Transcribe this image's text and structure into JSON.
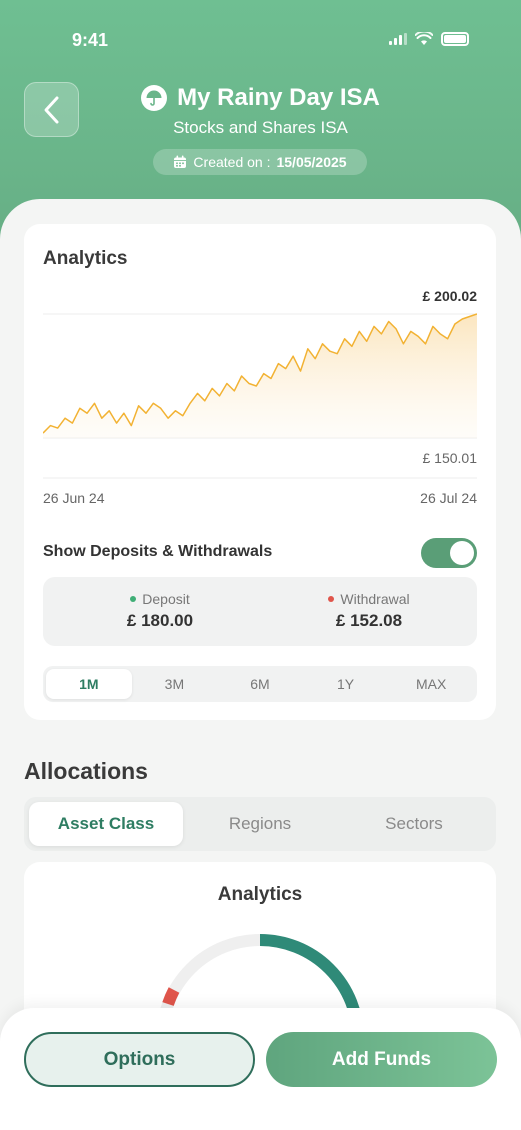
{
  "status_bar": {
    "time": "9:41"
  },
  "header": {
    "title": "My Rainy Day ISA",
    "subtitle": "Stocks and Shares ISA",
    "created_label": "Created on :",
    "created_date": "15/05/2025"
  },
  "analytics": {
    "title": "Analytics",
    "high_label": "£ 200.02",
    "low_label": "£ 150.01",
    "start_date": "26 Jun 24",
    "end_date": "26 Jul 24",
    "toggle_label": "Show Deposits & Withdrawals",
    "toggle_on": true,
    "deposit_label": "Deposit",
    "deposit_value": "£ 180.00",
    "withdrawal_label": "Withdrawal",
    "withdrawal_value": "£ 152.08",
    "ranges": [
      "1M",
      "3M",
      "6M",
      "1Y",
      "MAX"
    ],
    "active_range": "1M"
  },
  "chart_data": {
    "type": "area",
    "x": [
      "26 Jun 24",
      "26 Jul 24"
    ],
    "values": [
      152,
      155,
      154,
      158,
      156,
      162,
      160,
      164,
      158,
      161,
      156,
      160,
      155,
      163,
      160,
      164,
      162,
      158,
      161,
      159,
      164,
      168,
      165,
      170,
      167,
      172,
      169,
      175,
      172,
      171,
      176,
      174,
      180,
      178,
      183,
      177,
      186,
      182,
      188,
      185,
      184,
      190,
      187,
      193,
      189,
      195,
      192,
      197,
      194,
      188,
      193,
      191,
      188,
      195,
      192,
      190,
      196,
      198,
      199,
      200
    ],
    "ylim": [
      150.01,
      200.02
    ],
    "colors": {
      "line": "#f2b233",
      "fill": "#fbe7c4"
    }
  },
  "allocations": {
    "title": "Allocations",
    "tabs": [
      "Asset Class",
      "Regions",
      "Sectors"
    ],
    "active_tab": "Asset Class",
    "card_title": "Analytics"
  },
  "actions": {
    "options_label": "Options",
    "add_funds_label": "Add Funds"
  },
  "colors": {
    "brand": "#6ab58a",
    "accent_dark": "#2f6e5b",
    "deposit": "#3fae76",
    "withdrawal": "#e0554b"
  }
}
